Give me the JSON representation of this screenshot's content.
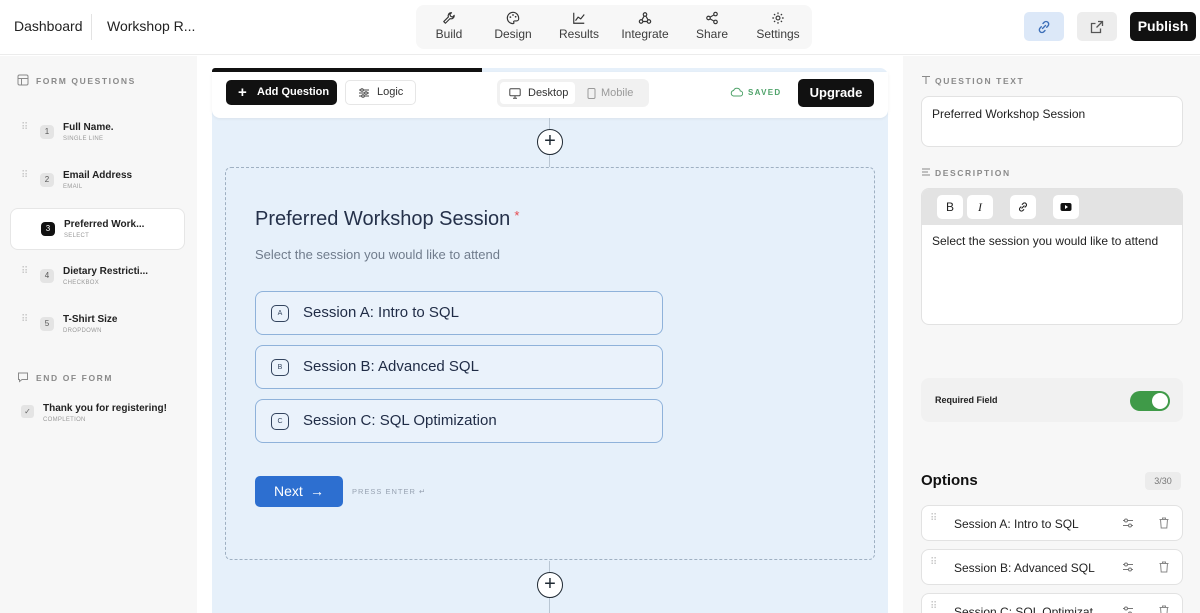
{
  "header": {
    "breadcrumb_root": "Dashboard",
    "form_title": "Workshop R...",
    "nav": [
      {
        "label": "Build",
        "icon": "wrench-icon"
      },
      {
        "label": "Design",
        "icon": "palette-icon"
      },
      {
        "label": "Results",
        "icon": "chart-icon"
      },
      {
        "label": "Integrate",
        "icon": "webhook-icon"
      },
      {
        "label": "Share",
        "icon": "share-icon"
      },
      {
        "label": "Settings",
        "icon": "gear-icon"
      }
    ],
    "publish_label": "Publish"
  },
  "sidebar": {
    "form_questions_label": "FORM QUESTIONS",
    "questions": [
      {
        "num": "1",
        "title": "Full Name.",
        "type": "SINGLE LINE"
      },
      {
        "num": "2",
        "title": "Email Address",
        "type": "EMAIL"
      },
      {
        "num": "3",
        "title": "Preferred Work...",
        "type": "SELECT",
        "active": true
      },
      {
        "num": "4",
        "title": "Dietary Restricti...",
        "type": "CHECKBOX"
      },
      {
        "num": "5",
        "title": "T-Shirt Size",
        "type": "DROPDOWN"
      }
    ],
    "end_of_form_label": "END OF FORM",
    "end_item": {
      "title": "Thank you for registering!",
      "type": "COMPLETION"
    }
  },
  "toolbar": {
    "add_question": "Add Question",
    "logic": "Logic",
    "desktop": "Desktop",
    "mobile": "Mobile",
    "saved": "SAVED",
    "upgrade": "Upgrade",
    "progress": 0.4
  },
  "question": {
    "title": "Preferred Workshop Session",
    "required_mark": "*",
    "description": "Select the session you would like to attend",
    "options": [
      {
        "key": "A",
        "label": "Session A: Intro to SQL"
      },
      {
        "key": "B",
        "label": "Session B: Advanced SQL"
      },
      {
        "key": "C",
        "label": "Session C: SQL Optimization"
      }
    ],
    "next_label": "Next",
    "enter_hint": "PRESS ENTER ↵"
  },
  "props": {
    "question_text_label": "QUESTION TEXT",
    "question_text_value": "Preferred Workshop Session",
    "description_label": "DESCRIPTION",
    "description_value": "Select the session you would like to attend",
    "required_label": "Required Field",
    "required_on": true,
    "options_heading": "Options",
    "options_count": "3/30",
    "options": [
      "Session A: Intro to SQL",
      "Session B: Advanced SQL",
      "Session C: SQL Optimizat"
    ]
  },
  "colors": {
    "accent": "#2d6fd0",
    "canvas_bg": "#e6f0fa",
    "toggle_on": "#3f9a48",
    "saved": "#4fa36a",
    "required": "#e5484d"
  }
}
